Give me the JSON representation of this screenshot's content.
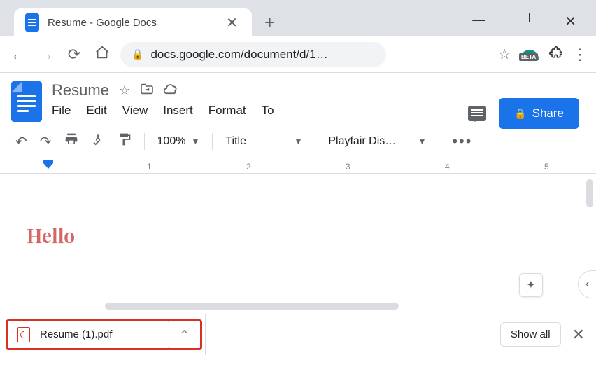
{
  "window": {
    "minimize": "—",
    "maximize": "",
    "close": "✕"
  },
  "tab": {
    "title": "Resume - Google Docs",
    "close": "✕",
    "newtab": "+"
  },
  "nav": {
    "back": "←",
    "forward": "→",
    "reload": "⟳",
    "home": "⌂"
  },
  "address": {
    "url": "docs.google.com/document/d/1…",
    "beta": "BETA"
  },
  "doc": {
    "title": "Resume",
    "menus": {
      "file": "File",
      "edit": "Edit",
      "view": "View",
      "insert": "Insert",
      "format": "Format",
      "tools": "To"
    },
    "share": "Share"
  },
  "toolbar": {
    "zoom": "100%",
    "style": "Title",
    "font": "Playfair Dis…"
  },
  "ruler": {
    "m1": "1",
    "m2": "2",
    "m3": "3",
    "m4": "4",
    "m5": "5"
  },
  "page": {
    "text": "Hello"
  },
  "downloads": {
    "file": "Resume (1).pdf",
    "showall": "Show all",
    "close": "✕",
    "caret": "⌃"
  }
}
